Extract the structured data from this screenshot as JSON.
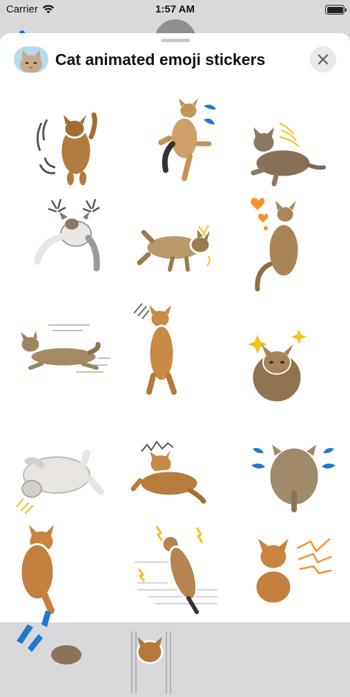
{
  "status_bar": {
    "carrier": "Carrier",
    "time": "1:57 AM"
  },
  "header": {
    "title": "Cat animated emoji stickers"
  },
  "colors": {
    "orange_cat": "#c98a45",
    "dark_cat": "#7a6a52",
    "white_cat": "#e8e4e0",
    "accent_blue": "#1f78d1",
    "accent_yellow": "#f2c21b",
    "accent_orange": "#f7902a",
    "sheet_bg": "#ffffff"
  },
  "stickers": [
    {
      "name": "cat-jumping-sticker"
    },
    {
      "name": "cat-sitting-sweat-sticker"
    },
    {
      "name": "tabby-lying-sticker"
    },
    {
      "name": "cat-angry-sticker"
    },
    {
      "name": "cat-rolling-sticker"
    },
    {
      "name": "cat-hearts-sticker"
    },
    {
      "name": "cat-running-sticker"
    },
    {
      "name": "cat-standing-sticker"
    },
    {
      "name": "cat-sparkle-sticker"
    },
    {
      "name": "white-cat-rolling-sticker"
    },
    {
      "name": "cat-lying-tired-sticker"
    },
    {
      "name": "cat-back-shock-sticker"
    },
    {
      "name": "cat-peeking-sticker"
    },
    {
      "name": "cat-jump-lightning-sticker"
    },
    {
      "name": "cat-zap-sticker"
    },
    {
      "name": "cat-partial-1-sticker"
    },
    {
      "name": "cat-partial-2-sticker"
    }
  ]
}
